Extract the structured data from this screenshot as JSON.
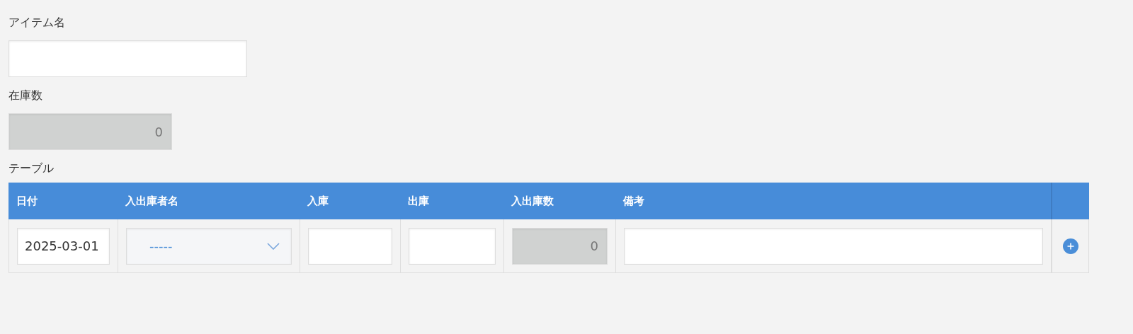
{
  "fields": [
    {
      "kind": "text",
      "label": "アイテム名"
    },
    {
      "kind": "computed",
      "label": "在庫数",
      "value": "0"
    }
  ],
  "table": {
    "title": "テーブル",
    "columns": [
      "日付",
      "入出庫者名",
      "入庫",
      "出庫",
      "入出庫数",
      "備考"
    ],
    "rows": [
      {
        "cells": [
          {
            "kind": "text",
            "value": "2025-03-01"
          },
          {
            "kind": "select",
            "value": "-----"
          },
          {
            "kind": "text"
          },
          {
            "kind": "text"
          },
          {
            "kind": "computed",
            "value": "0"
          },
          {
            "kind": "text"
          }
        ]
      }
    ]
  }
}
